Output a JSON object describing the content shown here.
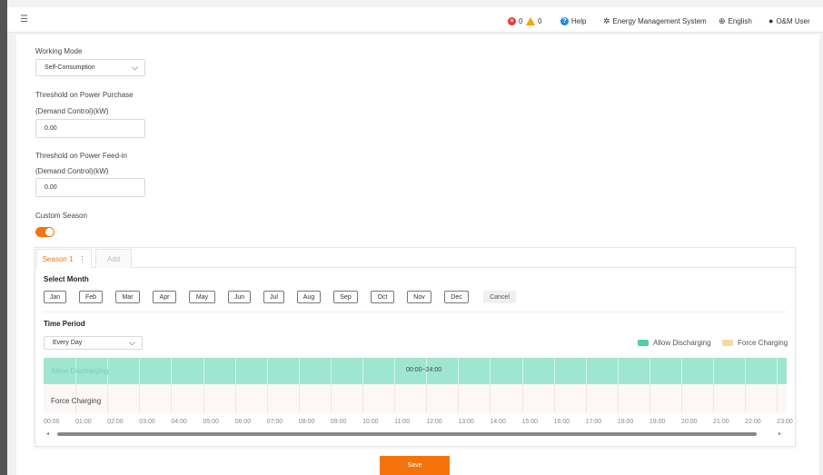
{
  "header": {
    "error_count": "0",
    "warning_count": "0",
    "help_label": "Help",
    "system_label": "Energy Management System",
    "language_label": "English",
    "user_label": "O&M User"
  },
  "form": {
    "working_mode_label": "Working Mode",
    "working_mode_value": "Self-Consumption",
    "purchase_label_1": "Threshold on Power Purchase",
    "purchase_label_2": "(Demand Control)(kW)",
    "purchase_value": "0.00",
    "feedin_label_1": "Threshold on Power Feed-in",
    "feedin_label_2": "(Demand Control)(kW)",
    "feedin_value": "0.00",
    "custom_season_label": "Custom Season",
    "custom_season_on": true
  },
  "season": {
    "tabs": [
      {
        "label": "Season 1",
        "active": true
      },
      {
        "label": "Add",
        "active": false
      }
    ],
    "select_month_title": "Select Month",
    "months": [
      "Jan",
      "Feb",
      "Mar",
      "Apr",
      "May",
      "Jun",
      "Jul",
      "Aug",
      "Sep",
      "Oct",
      "Nov",
      "Dec"
    ],
    "cancel_label": "Cancel",
    "time_period_title": "Time Period",
    "period_value": "Every Day",
    "legend": [
      {
        "label": "Allow Discharging",
        "color": "#4fcfa8"
      },
      {
        "label": "Force Charging",
        "color": "#f7d6a7"
      }
    ],
    "rows": {
      "allow_label": "Allow Discharging",
      "force_label": "Force Charging",
      "allow_range": "00:00~24:00"
    },
    "hours": [
      "00:00",
      "01:00",
      "02:00",
      "03:00",
      "04:00",
      "05:00",
      "06:00",
      "07:00",
      "08:00",
      "09:00",
      "10:00",
      "11:00",
      "12:00",
      "13:00",
      "14:00",
      "15:00",
      "16:00",
      "17:00",
      "18:00",
      "19:00",
      "20:00",
      "21:00",
      "22:00",
      "23:00"
    ]
  },
  "footer": {
    "save_label": "Save"
  },
  "colors": {
    "accent": "#f5730a",
    "allow": "#9ee6d0",
    "error": "#e53935",
    "warning": "#f0a500",
    "help": "#1e88e5"
  }
}
